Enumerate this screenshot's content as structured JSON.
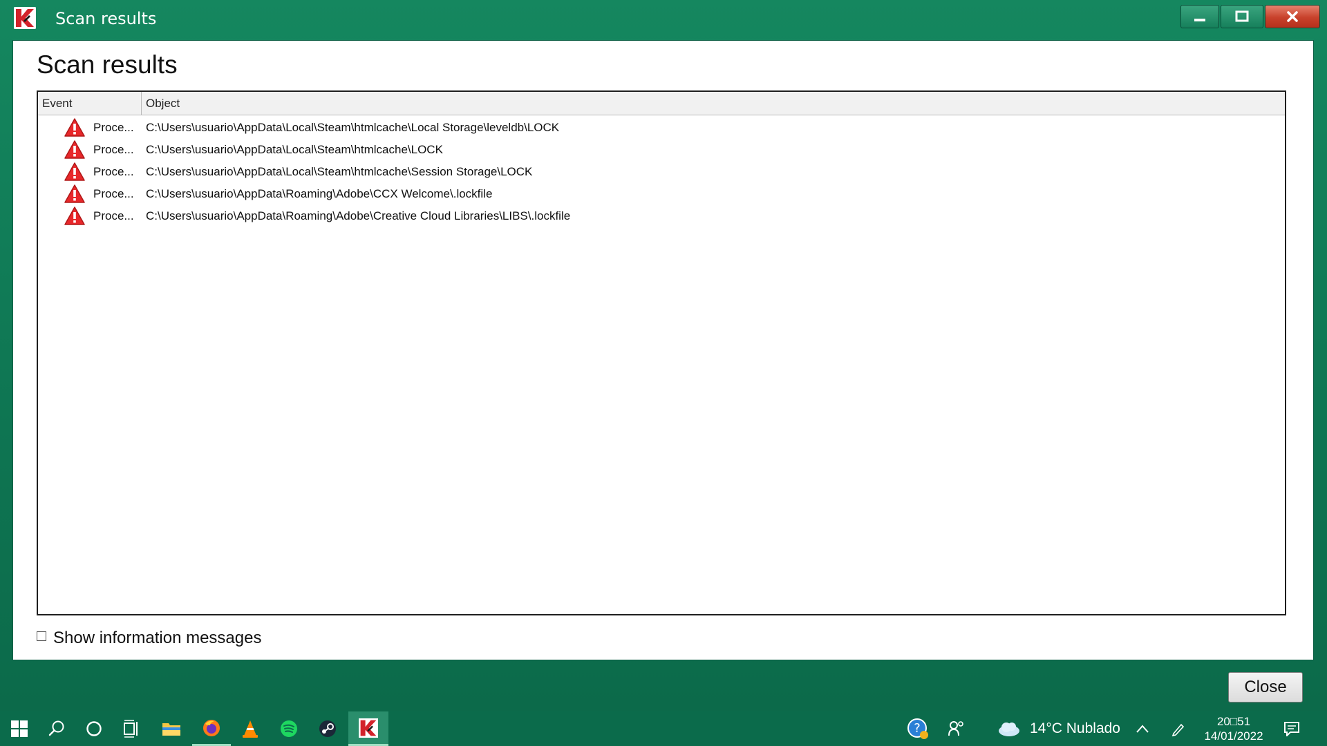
{
  "window": {
    "title": "Scan results",
    "controls": {
      "minimize": "minimize",
      "maximize": "maximize",
      "close": "close"
    }
  },
  "panel": {
    "heading": "Scan results",
    "columns": {
      "event": "Event",
      "object": "Object"
    },
    "rows": [
      {
        "event": "Proce...",
        "object": "C:\\Users\\usuario\\AppData\\Local\\Steam\\htmlcache\\Local Storage\\leveldb\\LOCK"
      },
      {
        "event": "Proce...",
        "object": "C:\\Users\\usuario\\AppData\\Local\\Steam\\htmlcache\\LOCK"
      },
      {
        "event": "Proce...",
        "object": "C:\\Users\\usuario\\AppData\\Local\\Steam\\htmlcache\\Session Storage\\LOCK"
      },
      {
        "event": "Proce...",
        "object": "C:\\Users\\usuario\\AppData\\Roaming\\Adobe\\CCX Welcome\\.lockfile"
      },
      {
        "event": "Proce...",
        "object": "C:\\Users\\usuario\\AppData\\Roaming\\Adobe\\Creative Cloud Libraries\\LIBS\\.lockfile"
      }
    ],
    "row_icon": "warning-icon",
    "show_info_label": "Show information messages",
    "show_info_checked": false
  },
  "footer": {
    "close_label": "Close"
  },
  "taskbar": {
    "apps": [
      "windows-start-icon",
      "search-icon",
      "cortana-icon",
      "task-view-icon",
      "file-explorer-icon",
      "firefox-icon",
      "vlc-icon",
      "spotify-icon",
      "steam-icon",
      "kaspersky-icon"
    ],
    "weather": "14°C  Nublado",
    "time": "20□51",
    "date": "14/01/2022"
  },
  "colors": {
    "window_green": "#15875f",
    "warning_red": "#e8282b",
    "close_red": "#c8412b"
  }
}
